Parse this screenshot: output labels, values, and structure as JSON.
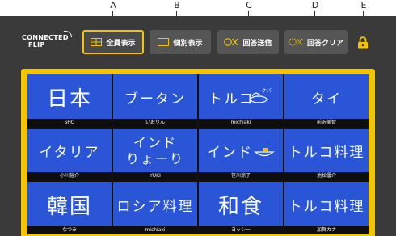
{
  "callouts": [
    "A",
    "B",
    "C",
    "D",
    "E"
  ],
  "app": {
    "logo_line1": "CONNECTED",
    "logo_line2": "FLIP"
  },
  "toolbar": {
    "show_all_label": "全員表示",
    "show_individual_label": "個別表示",
    "send_answers_label": "回答送信",
    "clear_answers_label": "回答クリア"
  },
  "colors": {
    "accent": "#f2c500",
    "panel_blue": "#2a55d6",
    "background": "#3a3a3a"
  },
  "answers": [
    {
      "text": "日本",
      "name": "SHO"
    },
    {
      "text": "ブータン",
      "name": "いおりん"
    },
    {
      "text": "トルコ",
      "name": "michiaki"
    },
    {
      "text": "タイ",
      "name": "前沢美智"
    },
    {
      "text": "イタリア",
      "name": "小川裕介"
    },
    {
      "text": "インド",
      "text2": "りょーり",
      "name": "YUKI"
    },
    {
      "text": "インド",
      "name": "笹川涼子"
    },
    {
      "text": "トルコ料理",
      "name": "池松優介"
    },
    {
      "text": "韓国",
      "name": "なつみ"
    },
    {
      "text": "ロシア料理",
      "name": "michiaki"
    },
    {
      "text": "和食",
      "name": "ヨッシー"
    },
    {
      "text": "トルコ料理",
      "name": "加賀カナ"
    }
  ]
}
